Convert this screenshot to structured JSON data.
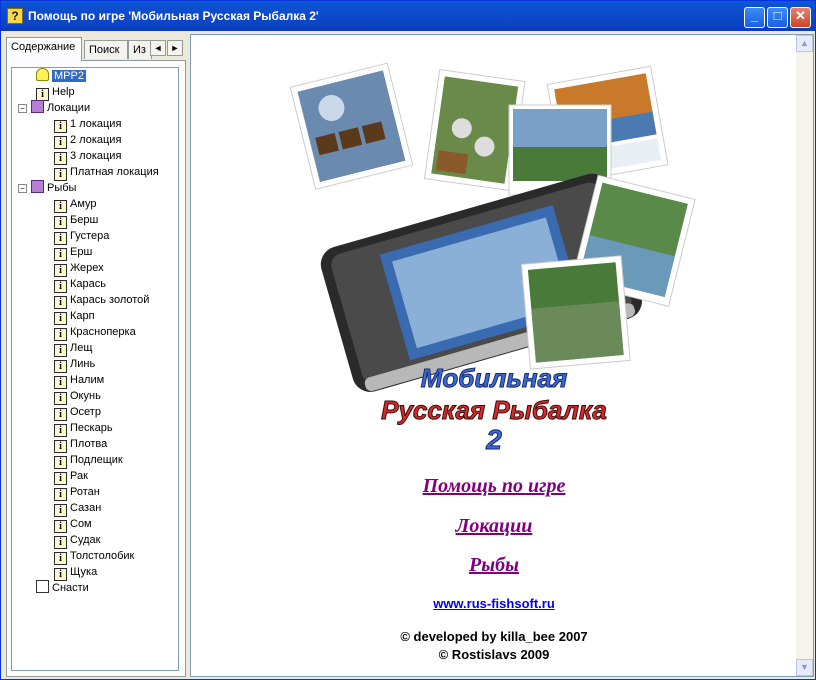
{
  "window": {
    "title": "Помощь по игре 'Мобильная Русская Рыбалка 2'",
    "buttons": {
      "minimize": "_",
      "maximize": "□",
      "close": "✕"
    }
  },
  "tabs": [
    {
      "label": "Содержание",
      "active": true
    },
    {
      "label": "Поиск",
      "active": false
    },
    {
      "label": "Из",
      "active": false
    }
  ],
  "tab_arrows": {
    "left": "◄",
    "right": "►"
  },
  "tree": {
    "root": "MPP2",
    "help": "Help",
    "locations": {
      "label": "Локации",
      "expander": "−",
      "items": [
        "1 локация",
        "2 локация",
        "3 локация",
        "Платная локация"
      ]
    },
    "fish": {
      "label": "Рыбы",
      "expander": "−",
      "items": [
        "Амур",
        "Берш",
        "Густера",
        "Ерш",
        "Жерех",
        "Карась",
        "Карась золотой",
        "Карп",
        "Красноперка",
        "Лещ",
        "Линь",
        "Налим",
        "Окунь",
        "Осетр",
        "Пескарь",
        "Плотва",
        "Подлещик",
        "Рак",
        "Ротан",
        "Сазан",
        "Сом",
        "Судак",
        "Толстолобик",
        "Щука"
      ]
    },
    "tackle": "Снасти"
  },
  "banner": {
    "line1": "Мобильная",
    "line2": "Русская Рыбалка",
    "line3": "2"
  },
  "links": {
    "help": "Помощь по игре",
    "locations": "Локации",
    "fish": "Рыбы",
    "site": "www.rus-fishsoft.ru"
  },
  "credits": {
    "line1": "© developed by killa_bee 2007",
    "line2": "© Rostislavs 2009"
  },
  "scrollbar": {
    "up": "▲",
    "down": "▼"
  },
  "colors": {
    "titlebar": "#0b4fd0",
    "visited_link": "#800080",
    "url_link": "#0000ee",
    "selection": "#316ac5"
  }
}
